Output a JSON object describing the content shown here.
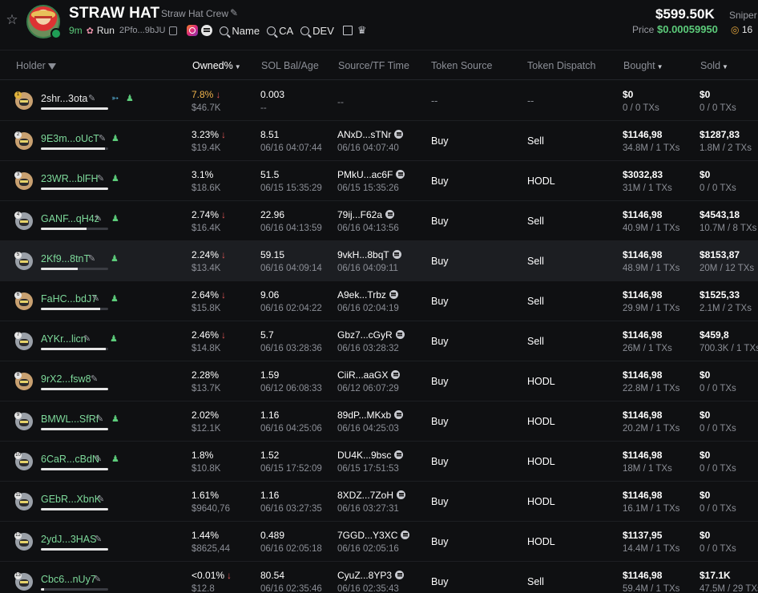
{
  "token": {
    "name": "STRAW HAT",
    "subtitle": "Straw Hat Crew",
    "age": "9m",
    "run_label": "Run",
    "address": "2Pfo...9bJU",
    "search_name": "Name",
    "search_ca": "CA",
    "search_dev": "DEV",
    "market_cap": "$599.50K",
    "price_label": "Price",
    "price_value": "$0.00059950",
    "sniper_label": "Sniper",
    "sniper_value": "16",
    "icons": [
      "star-icon",
      "edit-icon",
      "flower-icon",
      "copy-icon",
      "instagram-icon",
      "coin-icon",
      "search-icon",
      "share-icon",
      "crown-icon",
      "target-icon"
    ]
  },
  "colors": {
    "background": "#0f1012",
    "positive": "#5ccb7a",
    "negative": "#e05555",
    "highlight": "#f0b44c",
    "muted": "#8b8e96"
  },
  "columns": {
    "holder": "Holder",
    "owned": "Owned%",
    "sol": "SOL Bal/Age",
    "source": "Source/TF Time",
    "token_source": "Token Source",
    "token_dispatch": "Token Dispatch",
    "bought": "Bought",
    "sold": "Sold"
  },
  "rows": [
    {
      "addr": "2shr...3ota",
      "rank": "1",
      "owned": "7.8%",
      "owned_usd": "$46.7K",
      "sol": "0.003",
      "sol_date": "--",
      "src": "--",
      "src_date": "",
      "tsrc": "--",
      "tdisp": "--",
      "bought": "$0",
      "bought_sub": "0 / 0 TXs",
      "sold": "$0",
      "sold_sub": "0 / 0 TXs",
      "bar": 1.0
    },
    {
      "addr": "9E3m...oUcT",
      "rank": "2",
      "owned": "3.23%",
      "owned_usd": "$19.4K",
      "sol": "8.51",
      "sol_date": "06/16 04:07:44",
      "src": "ANxD...sTNr",
      "src_date": "06/16 04:07:40",
      "tsrc": "Buy",
      "tdisp": "Sell",
      "bought": "$1146,98",
      "bought_sub": "34.8M / 1 TXs",
      "sold": "$1287,83",
      "sold_sub": "1.8M / 2 TXs",
      "bar": 0.95
    },
    {
      "addr": "23WR...blFH",
      "rank": "3",
      "owned": "3.1%",
      "owned_usd": "$18.6K",
      "sol": "51.5",
      "sol_date": "06/15 15:35:29",
      "src": "PMkU...ac6F",
      "src_date": "06/15 15:35:26",
      "tsrc": "Buy",
      "tdisp": "HODL",
      "bought": "$3032,83",
      "bought_sub": "31M / 1 TXs",
      "sold": "$0",
      "sold_sub": "0 / 0 TXs",
      "bar": 1.0
    },
    {
      "addr": "GANF...qH4z",
      "rank": "4",
      "owned": "2.74%",
      "owned_usd": "$16.4K",
      "sol": "22.96",
      "sol_date": "06/16 04:13:59",
      "src": "79ij...F62a",
      "src_date": "06/16 04:13:56",
      "tsrc": "Buy",
      "tdisp": "Sell",
      "bought": "$1146,98",
      "bought_sub": "40.9M / 1 TXs",
      "sold": "$4543,18",
      "sold_sub": "10.7M / 8 TXs",
      "bar": 0.68
    },
    {
      "addr": "2Kf9...8tnT",
      "rank": "5",
      "owned": "2.24%",
      "owned_usd": "$13.4K",
      "sol": "59.15",
      "sol_date": "06/16 04:09:14",
      "src": "9vkH...8bqT",
      "src_date": "06/16 04:09:11",
      "tsrc": "Buy",
      "tdisp": "Sell",
      "bought": "$1146,98",
      "bought_sub": "48.9M / 1 TXs",
      "sold": "$8153,87",
      "sold_sub": "20M / 12 TXs",
      "bar": 0.55
    },
    {
      "addr": "FaHC...bdJ7",
      "rank": "6",
      "owned": "2.64%",
      "owned_usd": "$15.8K",
      "sol": "9.06",
      "sol_date": "06/16 02:04:22",
      "src": "A9ek...Trbz",
      "src_date": "06/16 02:04:19",
      "tsrc": "Buy",
      "tdisp": "Sell",
      "bought": "$1146,98",
      "bought_sub": "29.9M / 1 TXs",
      "sold": "$1525,33",
      "sold_sub": "2.1M / 2 TXs",
      "bar": 0.88
    },
    {
      "addr": "AYKr...licn",
      "rank": "7",
      "owned": "2.46%",
      "owned_usd": "$14.8K",
      "sol": "5.7",
      "sol_date": "06/16 03:28:36",
      "src": "Gbz7...cGyR",
      "src_date": "06/16 03:28:32",
      "tsrc": "Buy",
      "tdisp": "Sell",
      "bought": "$1146,98",
      "bought_sub": "26M / 1 TXs",
      "sold": "$459,8",
      "sold_sub": "700.3K / 1 TXs",
      "bar": 0.97
    },
    {
      "addr": "9rX2...fsw8",
      "rank": "8",
      "owned": "2.28%",
      "owned_usd": "$13.7K",
      "sol": "1.59",
      "sol_date": "06/12 06:08:33",
      "src": "CiiR...aaGX",
      "src_date": "06/12 06:07:29",
      "tsrc": "Buy",
      "tdisp": "HODL",
      "bought": "$1146,98",
      "bought_sub": "22.8M / 1 TXs",
      "sold": "$0",
      "sold_sub": "0 / 0 TXs",
      "bar": 1.0
    },
    {
      "addr": "BMWL...SfRf",
      "rank": "9",
      "owned": "2.02%",
      "owned_usd": "$12.1K",
      "sol": "1.16",
      "sol_date": "06/16 04:25:06",
      "src": "89dP...MKxb",
      "src_date": "06/16 04:25:03",
      "tsrc": "Buy",
      "tdisp": "HODL",
      "bought": "$1146,98",
      "bought_sub": "20.2M / 1 TXs",
      "sold": "$0",
      "sold_sub": "0 / 0 TXs",
      "bar": 1.0
    },
    {
      "addr": "6CaR...cBdN",
      "rank": "10",
      "owned": "1.8%",
      "owned_usd": "$10.8K",
      "sol": "1.52",
      "sol_date": "06/15 17:52:09",
      "src": "DU4K...9bsc",
      "src_date": "06/15 17:51:53",
      "tsrc": "Buy",
      "tdisp": "HODL",
      "bought": "$1146,98",
      "bought_sub": "18M / 1 TXs",
      "sold": "$0",
      "sold_sub": "0 / 0 TXs",
      "bar": 1.0
    },
    {
      "addr": "GEbR...XbnK",
      "rank": "11",
      "owned": "1.61%",
      "owned_usd": "$9640,76",
      "sol": "1.16",
      "sol_date": "06/16 03:27:35",
      "src": "8XDZ...7ZoH",
      "src_date": "06/16 03:27:31",
      "tsrc": "Buy",
      "tdisp": "HODL",
      "bought": "$1146,98",
      "bought_sub": "16.1M / 1 TXs",
      "sold": "$0",
      "sold_sub": "0 / 0 TXs",
      "bar": 1.0
    },
    {
      "addr": "2ydJ...3HAS",
      "rank": "12",
      "owned": "1.44%",
      "owned_usd": "$8625,44",
      "sol": "0.489",
      "sol_date": "06/16 02:05:18",
      "src": "7GGD...Y3XC",
      "src_date": "06/16 02:05:16",
      "tsrc": "Buy",
      "tdisp": "HODL",
      "bought": "$1137,95",
      "bought_sub": "14.4M / 1 TXs",
      "sold": "$0",
      "sold_sub": "0 / 0 TXs",
      "bar": 1.0
    },
    {
      "addr": "Cbc6...nUy7",
      "rank": "13",
      "owned": "<0.01%",
      "owned_usd": "$12.8",
      "sol": "80.54",
      "sol_date": "06/16 02:35:46",
      "src": "CyuZ...8YP3",
      "src_date": "06/16 02:35:43",
      "tsrc": "Buy",
      "tdisp": "Sell",
      "bought": "$1146,98",
      "bought_sub": "59.4M / 1 TXs",
      "sold": "$17.1K",
      "sold_sub": "47.5M / 29 TXs",
      "bar": 0.05
    }
  ]
}
